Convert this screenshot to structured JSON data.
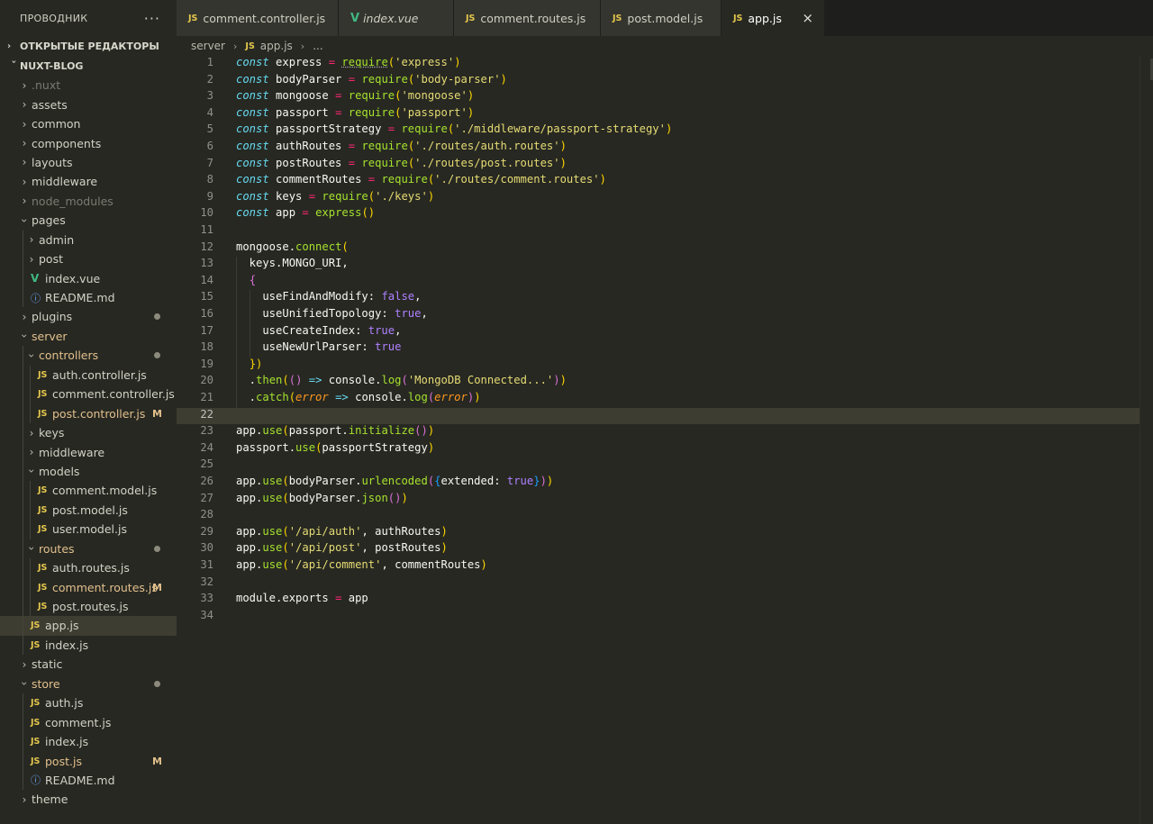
{
  "sidebar": {
    "title": "ПРОВОДНИК",
    "more_icon": "ellipsis-icon",
    "open_editors": "ОТКРЫТЫЕ РЕДАКТОРЫ",
    "project": "NUXT-BLOG",
    "items": [
      {
        "label": ".nuxt",
        "depth": 0,
        "type": "folder",
        "open": false,
        "dim": true
      },
      {
        "label": "assets",
        "depth": 0,
        "type": "folder",
        "open": false
      },
      {
        "label": "common",
        "depth": 0,
        "type": "folder",
        "open": false
      },
      {
        "label": "components",
        "depth": 0,
        "type": "folder",
        "open": false
      },
      {
        "label": "layouts",
        "depth": 0,
        "type": "folder",
        "open": false
      },
      {
        "label": "middleware",
        "depth": 0,
        "type": "folder",
        "open": false
      },
      {
        "label": "node_modules",
        "depth": 0,
        "type": "folder",
        "open": false,
        "dim": true
      },
      {
        "label": "pages",
        "depth": 0,
        "type": "folder",
        "open": true
      },
      {
        "label": "admin",
        "depth": 1,
        "type": "folder",
        "open": false
      },
      {
        "label": "post",
        "depth": 1,
        "type": "folder",
        "open": false
      },
      {
        "label": "index.vue",
        "depth": 1,
        "type": "vue"
      },
      {
        "label": "README.md",
        "depth": 1,
        "type": "info"
      },
      {
        "label": "plugins",
        "depth": 0,
        "type": "folder",
        "open": false,
        "dot": true
      },
      {
        "label": "server",
        "depth": 0,
        "type": "folder",
        "open": true,
        "git": true
      },
      {
        "label": "controllers",
        "depth": 1,
        "type": "folder",
        "open": true,
        "git": true,
        "dot": true
      },
      {
        "label": "auth.controller.js",
        "depth": 2,
        "type": "js"
      },
      {
        "label": "comment.controller.js",
        "depth": 2,
        "type": "js"
      },
      {
        "label": "post.controller.js",
        "depth": 2,
        "type": "js",
        "git": true,
        "mark": "M"
      },
      {
        "label": "keys",
        "depth": 1,
        "type": "folder",
        "open": false
      },
      {
        "label": "middleware",
        "depth": 1,
        "type": "folder",
        "open": false
      },
      {
        "label": "models",
        "depth": 1,
        "type": "folder",
        "open": true
      },
      {
        "label": "comment.model.js",
        "depth": 2,
        "type": "js"
      },
      {
        "label": "post.model.js",
        "depth": 2,
        "type": "js"
      },
      {
        "label": "user.model.js",
        "depth": 2,
        "type": "js"
      },
      {
        "label": "routes",
        "depth": 1,
        "type": "folder",
        "open": true,
        "git": true,
        "dot": true
      },
      {
        "label": "auth.routes.js",
        "depth": 2,
        "type": "js"
      },
      {
        "label": "comment.routes.js",
        "depth": 2,
        "type": "js",
        "git": true,
        "mark": "M"
      },
      {
        "label": "post.routes.js",
        "depth": 2,
        "type": "js"
      },
      {
        "label": "app.js",
        "depth": 1,
        "type": "js",
        "selected": true
      },
      {
        "label": "index.js",
        "depth": 1,
        "type": "js"
      },
      {
        "label": "static",
        "depth": 0,
        "type": "folder",
        "open": false
      },
      {
        "label": "store",
        "depth": 0,
        "type": "folder",
        "open": true,
        "git": true,
        "dot": true
      },
      {
        "label": "auth.js",
        "depth": 1,
        "type": "js"
      },
      {
        "label": "comment.js",
        "depth": 1,
        "type": "js"
      },
      {
        "label": "index.js",
        "depth": 1,
        "type": "js"
      },
      {
        "label": "post.js",
        "depth": 1,
        "type": "js",
        "git": true,
        "mark": "M"
      },
      {
        "label": "README.md",
        "depth": 1,
        "type": "info"
      },
      {
        "label": "theme",
        "depth": 0,
        "type": "folder",
        "open": false
      }
    ]
  },
  "tabs": [
    {
      "label": "comment.controller.js",
      "icon": "js-icon",
      "active": false,
      "italic": false
    },
    {
      "label": "index.vue",
      "icon": "vue-icon",
      "active": false,
      "italic": true
    },
    {
      "label": "comment.routes.js",
      "icon": "js-icon",
      "active": false,
      "italic": false
    },
    {
      "label": "post.model.js",
      "icon": "js-icon",
      "active": false,
      "italic": false
    },
    {
      "label": "app.js",
      "icon": "js-icon",
      "active": true,
      "italic": false,
      "close": "×"
    }
  ],
  "breadcrumb": {
    "folder": "server",
    "file": "app.js",
    "more": "..."
  },
  "editor": {
    "current_line": 22,
    "lines": [
      "const express = require('express')",
      "const bodyParser = require('body-parser')",
      "const mongoose = require('mongoose')",
      "const passport = require('passport')",
      "const passportStrategy = require('./middleware/passport-strategy')",
      "const authRoutes = require('./routes/auth.routes')",
      "const postRoutes = require('./routes/post.routes')",
      "const commentRoutes = require('./routes/comment.routes')",
      "const keys = require('./keys')",
      "const app = express()",
      "",
      "mongoose.connect(",
      "  keys.MONGO_URI,",
      "  {",
      "    useFindAndModify: false,",
      "    useUnifiedTopology: true,",
      "    useCreateIndex: true,",
      "    useNewUrlParser: true",
      "  })",
      "  .then(() => console.log('MongoDB Connected...'))",
      "  .catch(error => console.log(error))",
      "",
      "app.use(passport.initialize())",
      "passport.use(passportStrategy)",
      "",
      "app.use(bodyParser.urlencoded({extended: true}))",
      "app.use(bodyParser.json())",
      "",
      "app.use('/api/auth', authRoutes)",
      "app.use('/api/post', postRoutes)",
      "app.use('/api/comment', commentRoutes)",
      "",
      "module.exports = app",
      ""
    ]
  }
}
